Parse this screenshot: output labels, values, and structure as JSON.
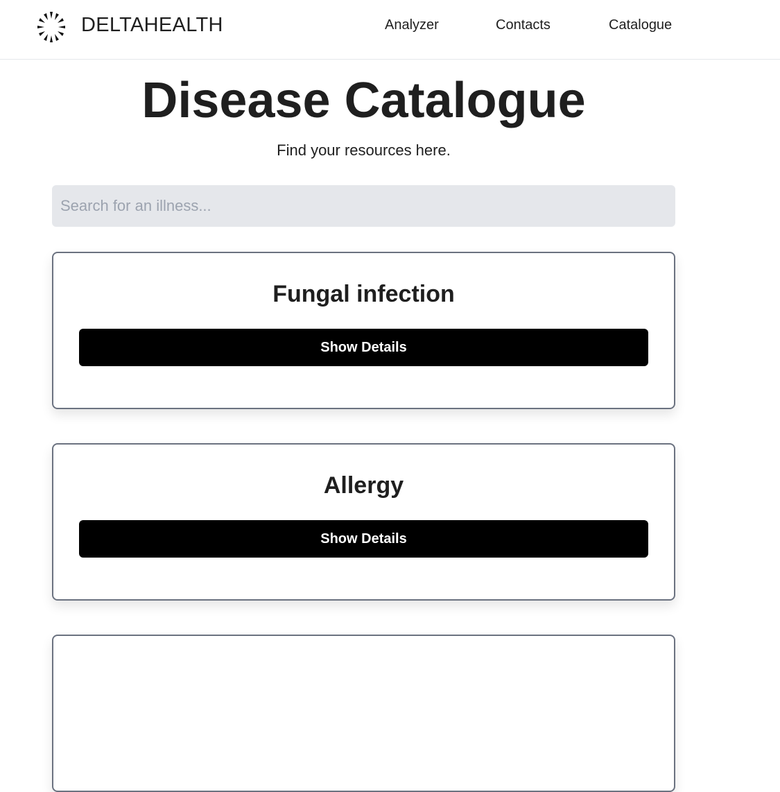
{
  "header": {
    "brand": "DELTAHEALTH",
    "logo_icon": "sunburst-logo-icon",
    "nav": [
      {
        "label": "Analyzer"
      },
      {
        "label": "Contacts"
      },
      {
        "label": "Catalogue"
      }
    ]
  },
  "main": {
    "title": "Disease Catalogue",
    "subtitle": "Find your resources here.",
    "search": {
      "placeholder": "Search for an illness...",
      "value": ""
    },
    "cards": [
      {
        "title": "Fungal infection",
        "button_label": "Show Details"
      },
      {
        "title": "Allergy",
        "button_label": "Show Details"
      },
      {
        "title": "",
        "button_label": ""
      }
    ]
  },
  "colors": {
    "button_bg": "#000000",
    "button_text": "#ffffff",
    "search_bg": "#e5e7eb",
    "card_border": "#6b7280"
  }
}
